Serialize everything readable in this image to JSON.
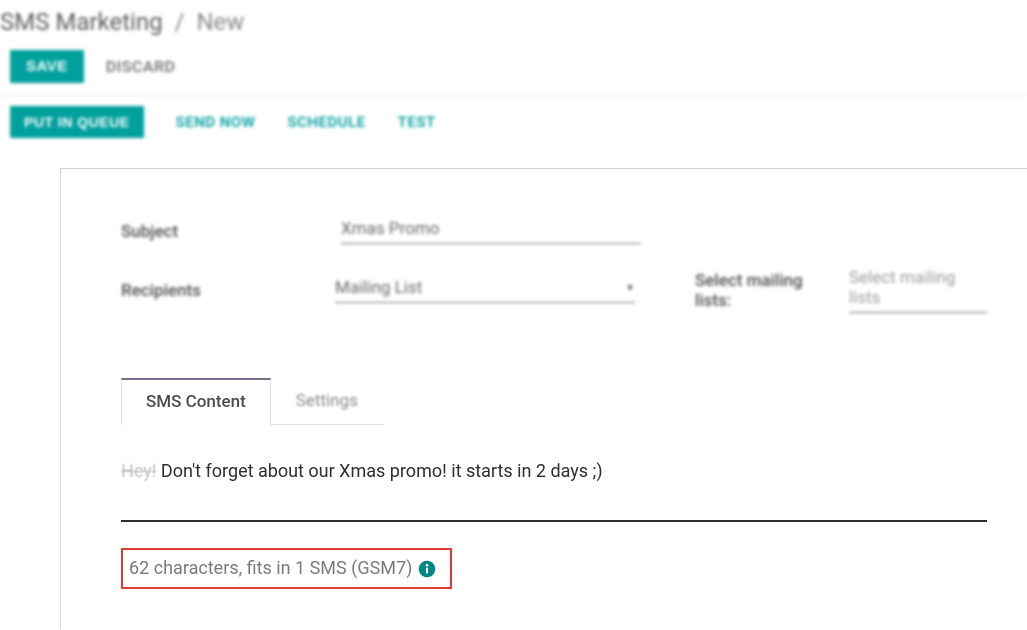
{
  "breadcrumb": {
    "root": "SMS Marketing",
    "current": "New"
  },
  "actions": {
    "save": "SAVE",
    "discard": "DISCARD"
  },
  "status": {
    "put_in_queue": "PUT IN QUEUE",
    "send_now": "SEND NOW",
    "schedule": "SCHEDULE",
    "test": "TEST"
  },
  "fields": {
    "subject": {
      "label": "Subject",
      "value": "Xmas Promo"
    },
    "recipients": {
      "label": "Recipients",
      "value": "Mailing List",
      "extra_label": "Select mailing lists:",
      "extra_placeholder": "Select mailing lists"
    }
  },
  "tabs": {
    "content": "SMS Content",
    "settings": "Settings"
  },
  "sms": {
    "ghost": "Hey!",
    "body": " Don't forget about our Xmas promo! it starts in 2 days ;)",
    "counter": "62 characters, fits in 1 SMS (GSM7)"
  }
}
